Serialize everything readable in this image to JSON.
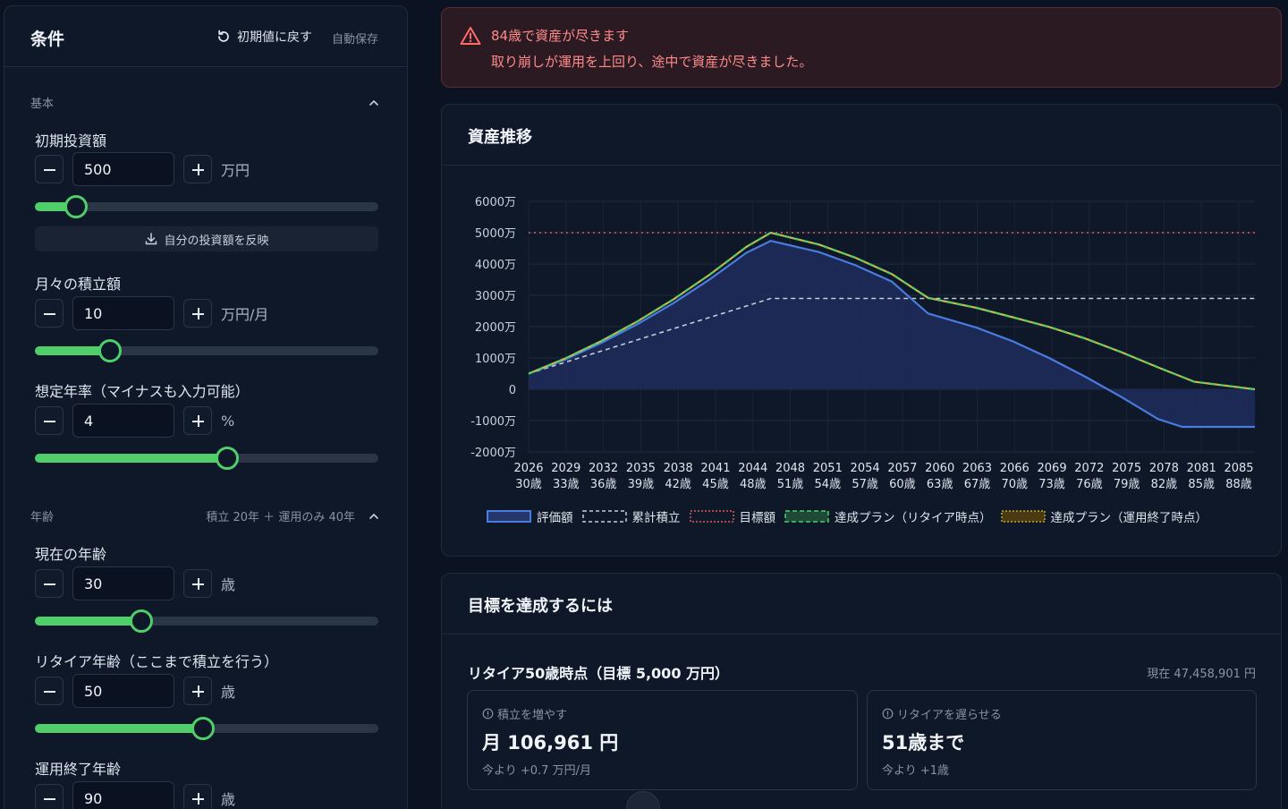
{
  "conditions": {
    "title": "条件",
    "reset_label": "初期値に戻す",
    "autosave_label": "自動保存",
    "basic_section": "基本",
    "age_section": "年齢",
    "age_summary": "積立 20年 ＋ 運用のみ 40年",
    "reflect_button": "自分の投資額を反映",
    "fields": [
      {
        "label": "初期投資額",
        "value": "500",
        "unit": "万円",
        "fraction": 0.12
      },
      {
        "label": "月々の積立額",
        "value": "10",
        "unit": "万円/月",
        "fraction": 0.22
      },
      {
        "label": "想定年率（マイナスも入力可能）",
        "value": "4",
        "unit": "%",
        "fraction": 0.56
      },
      {
        "label": "現在の年齢",
        "value": "30",
        "unit": "歳",
        "fraction": 0.31
      },
      {
        "label": "リタイア年齢（ここまで積立を行う）",
        "value": "50",
        "unit": "歳",
        "fraction": 0.49
      },
      {
        "label": "運用終了年齢",
        "value": "90",
        "unit": "歳"
      }
    ]
  },
  "alert": {
    "title": "84歳で資産が尽きます",
    "message": "取り崩しが運用を上回り、途中で資産が尽きました。"
  },
  "chart_card": {
    "title": "資産推移"
  },
  "chart_data": {
    "type": "line",
    "ytick_labels": [
      "6000万",
      "5000万",
      "4000万",
      "3000万",
      "2000万",
      "1000万",
      "0",
      "-1000万",
      "-2000万"
    ],
    "ylim": [
      -2000,
      6000
    ],
    "ytick_values": [
      6000,
      5000,
      4000,
      3000,
      2000,
      1000,
      0,
      -1000,
      -2000
    ],
    "x_years": [
      "2026",
      "2029",
      "2032",
      "2035",
      "2038",
      "2041",
      "2044",
      "2048",
      "2051",
      "2054",
      "2057",
      "2060",
      "2063",
      "2066",
      "2069",
      "2072",
      "2075",
      "2078",
      "2081",
      "2085"
    ],
    "x_ages": [
      "30歳",
      "33歳",
      "36歳",
      "39歳",
      "42歳",
      "45歳",
      "48歳",
      "51歳",
      "54歳",
      "57歳",
      "60歳",
      "63歳",
      "67歳",
      "70歳",
      "73歳",
      "76歳",
      "79歳",
      "82歳",
      "85歳",
      "88歳"
    ],
    "x_age_range": [
      30,
      90
    ],
    "series": [
      {
        "name": "評価額",
        "color": "#4a7be0",
        "style": "solid-area",
        "points": [
          [
            30,
            500
          ],
          [
            33,
            950
          ],
          [
            36,
            1480
          ],
          [
            39,
            2080
          ],
          [
            42,
            2760
          ],
          [
            45,
            3520
          ],
          [
            48,
            4360
          ],
          [
            50,
            4740
          ],
          [
            54,
            4380
          ],
          [
            57,
            3960
          ],
          [
            60,
            3440
          ],
          [
            63,
            2420
          ],
          [
            67,
            1970
          ],
          [
            70,
            1530
          ],
          [
            73,
            1000
          ],
          [
            76,
            400
          ],
          [
            79,
            -250
          ],
          [
            82,
            -950
          ],
          [
            84,
            -1200
          ],
          [
            90,
            -1200
          ]
        ]
      },
      {
        "name": "累計積立",
        "color": "#c5ccd6",
        "style": "dashed",
        "points": [
          [
            30,
            500
          ],
          [
            50,
            2900
          ],
          [
            90,
            2900
          ]
        ]
      },
      {
        "name": "目標額",
        "color": "#e05a5a",
        "style": "dotted",
        "points": [
          [
            30,
            5000
          ],
          [
            90,
            5000
          ]
        ]
      },
      {
        "name": "達成プラン（リタイア時点）",
        "color": "#4fce6a",
        "style": "dashed-green",
        "points": [
          [
            30,
            500
          ],
          [
            33,
            980
          ],
          [
            36,
            1540
          ],
          [
            39,
            2170
          ],
          [
            42,
            2880
          ],
          [
            45,
            3670
          ],
          [
            48,
            4550
          ],
          [
            50,
            5000
          ],
          [
            54,
            4620
          ],
          [
            57,
            4200
          ],
          [
            60,
            3680
          ],
          [
            63,
            2920
          ],
          [
            67,
            2600
          ],
          [
            70,
            2300
          ],
          [
            73,
            1990
          ],
          [
            76,
            1620
          ],
          [
            79,
            1180
          ],
          [
            82,
            700
          ],
          [
            85,
            240
          ],
          [
            90,
            0
          ]
        ]
      },
      {
        "name": "達成プラン（運用終了時点）",
        "color": "#c9a227",
        "style": "dotted-yellow",
        "points": []
      }
    ]
  },
  "goal_card": {
    "title": "目標を達成するには",
    "subtitle": "リタイア50歳時点（目標 5,000 万円）",
    "current": "現在 47,458,901 円",
    "options": [
      {
        "title": "積立を増やす",
        "value": "月 106,961 円",
        "delta": "今より +0.7 万円/月"
      },
      {
        "title": "リタイアを遅らせる",
        "value": "51歳まで",
        "delta": "今より +1歳"
      }
    ]
  }
}
